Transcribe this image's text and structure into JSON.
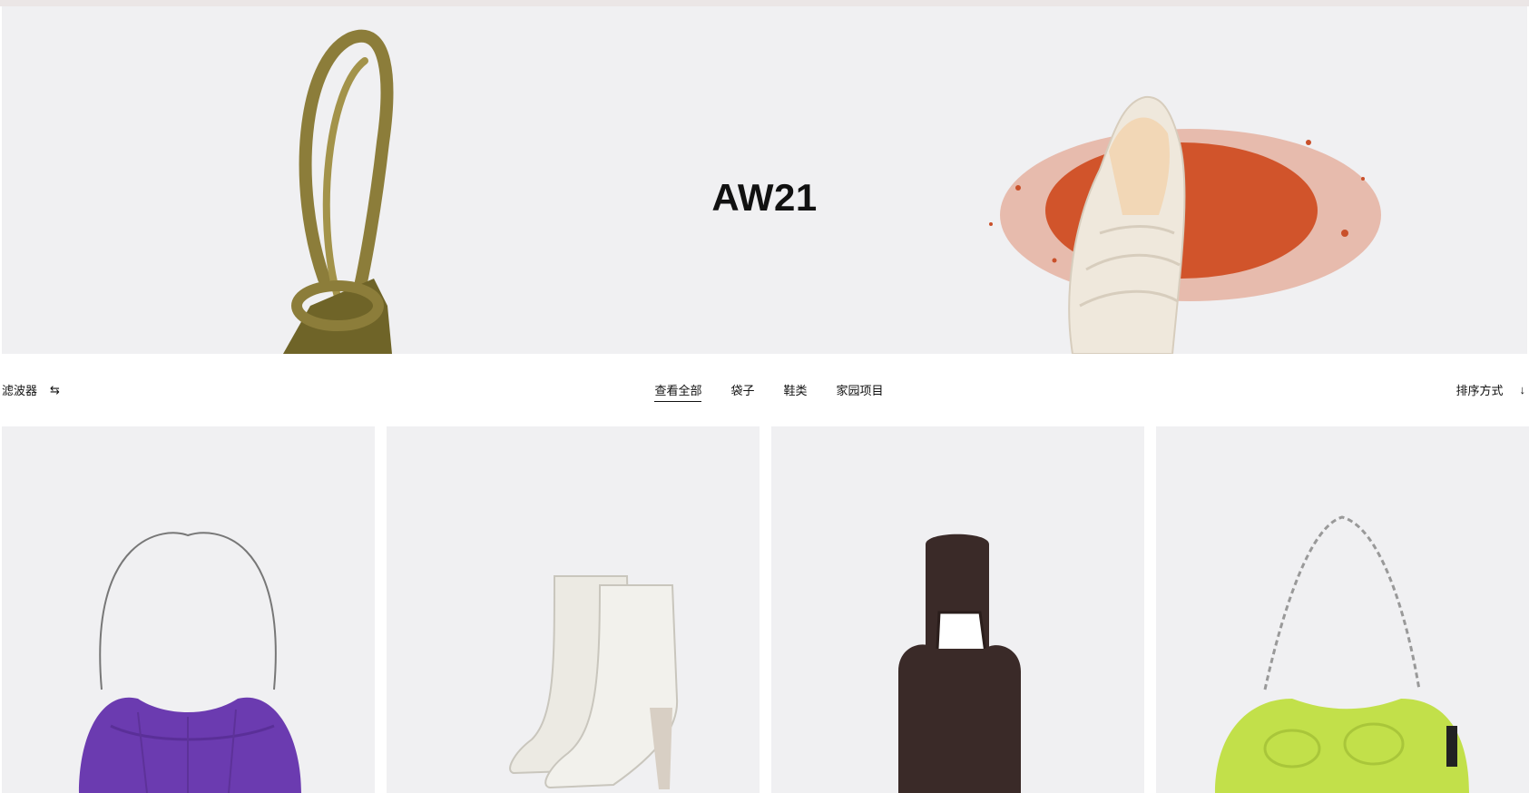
{
  "hero": {
    "title": "AW21"
  },
  "toolbar": {
    "filter_label": "滤波器",
    "filter_icon": "sliders-icon",
    "tabs": [
      {
        "label": "查看全部",
        "active": true
      },
      {
        "label": "袋子",
        "active": false
      },
      {
        "label": "鞋类",
        "active": false
      },
      {
        "label": "家园项目",
        "active": false
      }
    ],
    "sort_label": "排序方式",
    "sort_icon": "arrow-down-icon"
  },
  "products": [
    {
      "color": "#6b3bb0",
      "item": "purple-shoulder-bag"
    },
    {
      "color": "#e9e8e2",
      "item": "white-ankle-boots"
    },
    {
      "color": "#3a2a28",
      "item": "brown-bottle-bag"
    },
    {
      "color": "#c2e04a",
      "item": "lime-puffer-bag"
    }
  ],
  "colors": {
    "hero_bg": "#f0f0f2",
    "accent_text": "#111111"
  }
}
